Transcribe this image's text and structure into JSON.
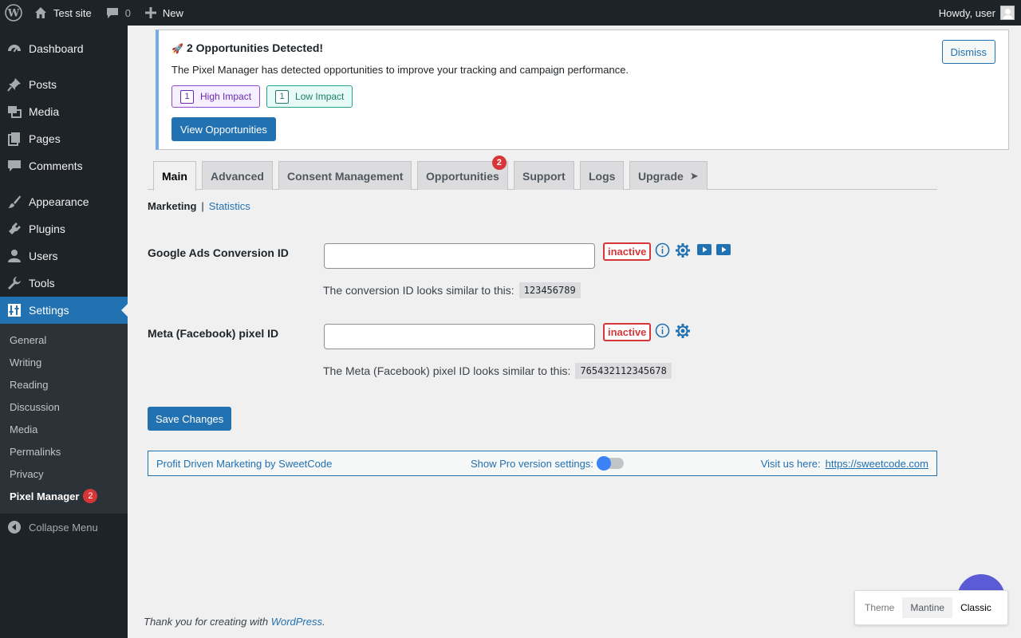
{
  "adminbar": {
    "site_name": "Test site",
    "comments_count": "0",
    "new_label": "New",
    "greeting": "Howdy, user"
  },
  "sidebar": {
    "items": [
      {
        "label": "Dashboard",
        "icon": "dashboard-icon"
      },
      {
        "label": "Posts",
        "icon": "pin-icon"
      },
      {
        "label": "Media",
        "icon": "media-icon"
      },
      {
        "label": "Pages",
        "icon": "pages-icon"
      },
      {
        "label": "Comments",
        "icon": "comment-icon"
      },
      {
        "label": "Appearance",
        "icon": "brush-icon"
      },
      {
        "label": "Plugins",
        "icon": "plugin-icon"
      },
      {
        "label": "Users",
        "icon": "user-icon"
      },
      {
        "label": "Tools",
        "icon": "wrench-icon"
      },
      {
        "label": "Settings",
        "icon": "settings-sliders-icon"
      }
    ],
    "submenu": [
      "General",
      "Writing",
      "Reading",
      "Discussion",
      "Media",
      "Permalinks",
      "Privacy"
    ],
    "pixel_manager_label": "Pixel Manager",
    "pixel_manager_count": "2",
    "collapse_label": "Collapse Menu"
  },
  "notice": {
    "title": "2 Opportunities Detected!",
    "text": "The Pixel Manager has detected opportunities to improve your tracking and campaign performance.",
    "high_count": "1",
    "high_label": "High Impact",
    "low_count": "1",
    "low_label": "Low Impact",
    "view_button": "View Opportunities",
    "dismiss_button": "Dismiss"
  },
  "tabs": {
    "main": "Main",
    "advanced": "Advanced",
    "consent": "Consent Management",
    "opportunities": "Opportunities",
    "opportunities_badge": "2",
    "support": "Support",
    "logs": "Logs",
    "upgrade": "Upgrade"
  },
  "subnav": {
    "current": "Marketing",
    "separator": "|",
    "statistics": "Statistics"
  },
  "fields": {
    "google_ads": {
      "label": "Google Ads Conversion ID",
      "value": "",
      "status": "inactive",
      "hint": "The conversion ID looks similar to this:",
      "example": "123456789"
    },
    "meta": {
      "label": "Meta (Facebook) pixel ID",
      "value": "",
      "status": "inactive",
      "hint": "The Meta (Facebook) pixel ID looks similar to this:",
      "example": "765432112345678"
    }
  },
  "save_button": "Save Changes",
  "promo": {
    "left": "Profit Driven Marketing by SweetCode",
    "toggle_label": "Show Pro version settings:",
    "toggle_on": false,
    "visit_label": "Visit us here:",
    "url": "https://sweetcode.com"
  },
  "footer": {
    "prefix": "Thank you for creating with",
    "link": "WordPress",
    "suffix": "."
  },
  "theme_switch": {
    "label": "Theme",
    "option_selected": "Mantine",
    "option_other": "Classic"
  },
  "colors": {
    "primary": "#2271b1",
    "error": "#d63638",
    "adminbar": "#1d2327"
  }
}
